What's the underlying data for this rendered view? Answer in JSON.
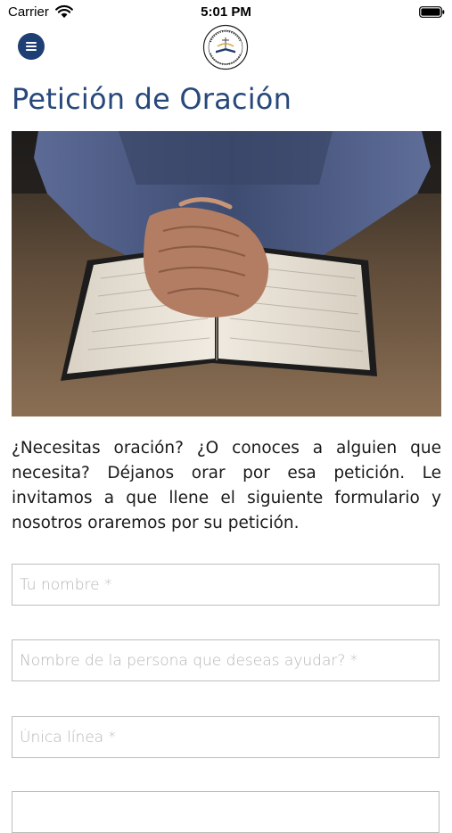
{
  "status_bar": {
    "carrier": "Carrier",
    "time": "5:01 PM"
  },
  "header": {
    "menu_icon": "hamburger-menu-icon",
    "logo": "church-logo-emblem"
  },
  "page": {
    "title": "Petición de Oración",
    "hero_image": "praying-hands-on-open-bible",
    "intro": "¿Necesitas oración? ¿O conoces a alguien que necesita? Déjanos orar por esa petición. Le invitamos a que llene el siguiente formulario y nosotros oraremos por su petición."
  },
  "form": {
    "name_placeholder": "Tu nombre *",
    "helped_person_placeholder": "Nombre de la persona que deseas ayudar? *",
    "single_line_placeholder": "Única línea *",
    "fourth_placeholder": ""
  },
  "colors": {
    "accent": "#1e3f73",
    "title": "#27487a"
  }
}
